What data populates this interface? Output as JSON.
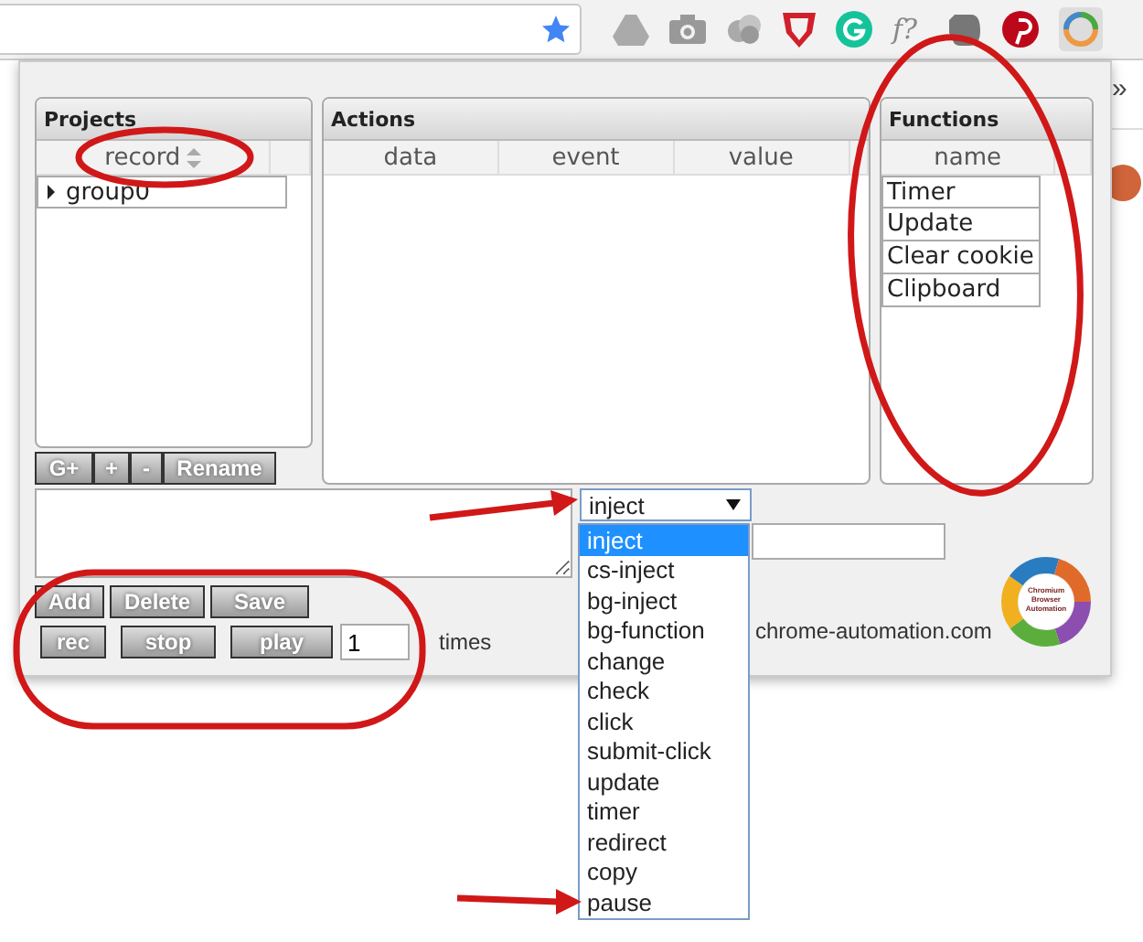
{
  "browser_toolbar": {
    "extension_label": "f?",
    "bookmarks_overflow": "»"
  },
  "projects": {
    "title": "Projects",
    "column": "record",
    "rows": [
      {
        "label": "group0",
        "expanded": false
      }
    ],
    "buttons": [
      "G+",
      "+",
      "-",
      "Rename"
    ]
  },
  "actions": {
    "title": "Actions",
    "columns": [
      "data",
      "event",
      "value"
    ]
  },
  "functions": {
    "title": "Functions",
    "column": "name",
    "rows": [
      "Timer",
      "Update",
      "Clear cookie",
      "Clipboard"
    ]
  },
  "action_type": {
    "value": "inject",
    "expanded": true,
    "options": [
      {
        "label": "inject",
        "selected": true
      },
      {
        "label": "cs-inject",
        "selected": false
      },
      {
        "label": "bg-inject",
        "selected": false
      },
      {
        "label": "bg-function",
        "selected": false
      },
      {
        "label": "change",
        "selected": false
      },
      {
        "label": "check",
        "selected": false
      },
      {
        "label": "click",
        "selected": false
      },
      {
        "label": "submit-click",
        "selected": false
      },
      {
        "label": "update",
        "selected": false
      },
      {
        "label": "timer",
        "selected": false
      },
      {
        "label": "redirect",
        "selected": false
      },
      {
        "label": "copy",
        "selected": false
      },
      {
        "label": "pause",
        "selected": false
      }
    ]
  },
  "edit_buttons": [
    "Add",
    "Delete",
    "Save"
  ],
  "play_buttons": [
    "rec",
    "stop",
    "play"
  ],
  "repeat": {
    "value": "1",
    "unit": "times"
  },
  "site": "chrome-automation.com",
  "logo_caption": "Chromium Browser Automation"
}
